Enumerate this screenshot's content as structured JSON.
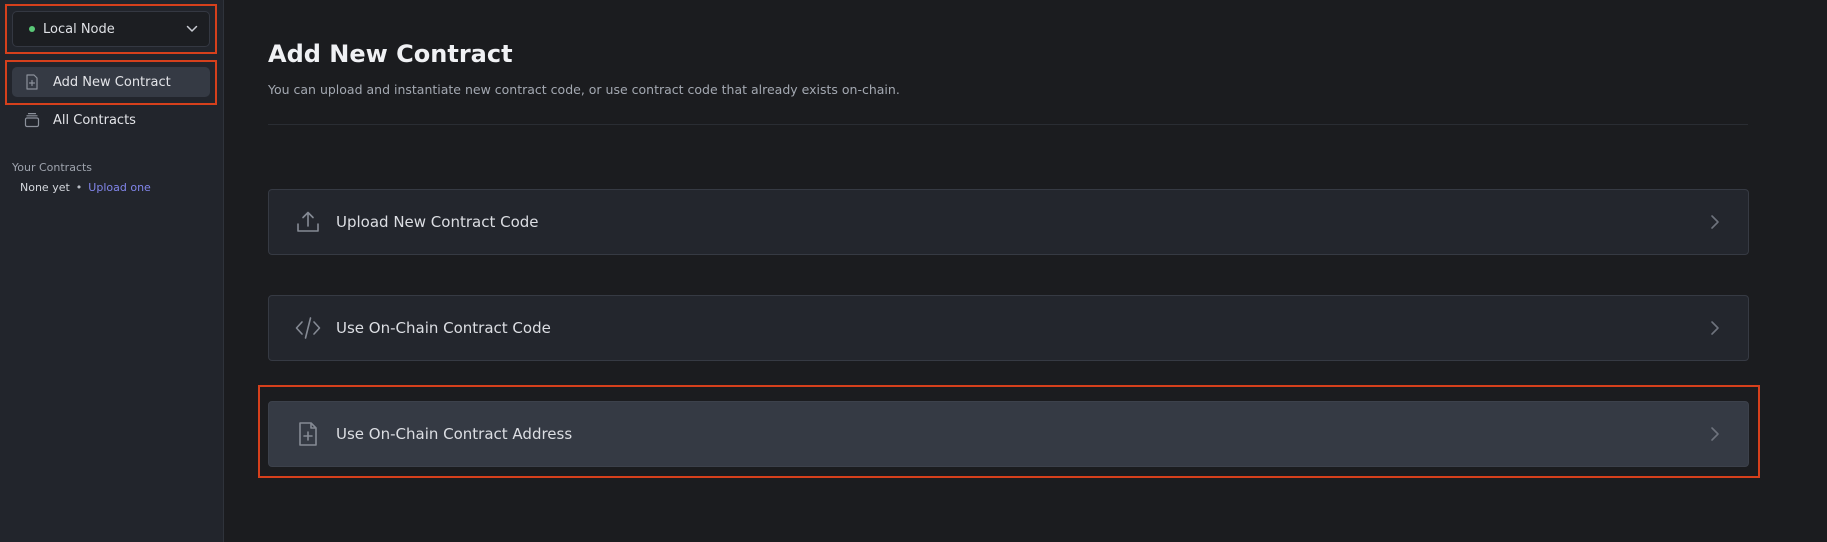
{
  "sidebar": {
    "network_select": {
      "value": "Local Node",
      "status_color": "#5ac978"
    },
    "nav": [
      {
        "label": "Add New Contract",
        "icon": "file-plus-icon",
        "active": true
      },
      {
        "label": "All Contracts",
        "icon": "stack-icon",
        "active": false
      }
    ],
    "your_contracts": {
      "title": "Your Contracts",
      "empty_text": "None yet",
      "separator": "•",
      "upload_link": "Upload one"
    }
  },
  "main": {
    "title": "Add New Contract",
    "subtitle": "You can upload and instantiate new contract code, or use contract code that already exists on-chain.",
    "options": [
      {
        "label": "Upload New Contract Code",
        "icon": "upload-icon"
      },
      {
        "label": "Use On-Chain Contract Code",
        "icon": "code-icon"
      },
      {
        "label": "Use On-Chain Contract Address",
        "icon": "file-plus-icon",
        "selected": true
      }
    ]
  },
  "colors": {
    "highlight_box": "#d6401c",
    "link": "#8185ea",
    "background": "#1b1c1f",
    "sidebar": "#22252c"
  }
}
